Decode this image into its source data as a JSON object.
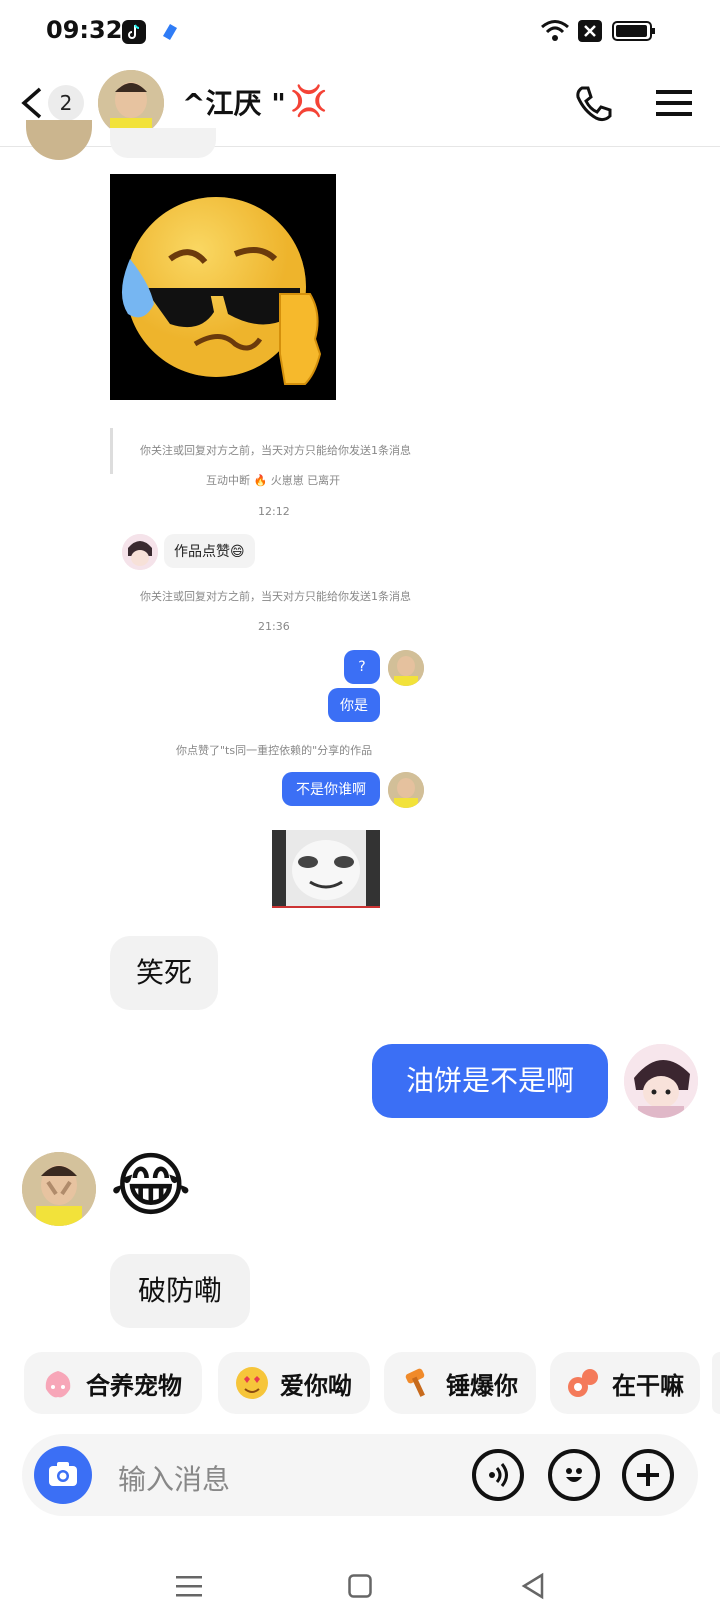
{
  "status": {
    "time": "09:32"
  },
  "header": {
    "unread_count": "2",
    "contact_name": "^江厌 \"",
    "anger_emoji": "💢"
  },
  "messages": {
    "mini": {
      "note1": "你关注或回复对方之前，当天对方只能给你发送1条消息",
      "note2": "互动中断 🔥 火崽崽 已离开",
      "time1": "12:12",
      "in1": "作品点赞😄",
      "note3": "你关注或回复对方之前，当天对方只能给你发送1条消息",
      "time2": "21:36",
      "out1": "?",
      "out2": "你是",
      "note4": "你点赞了\"ts同一重控依赖的\"分享的作品",
      "out3": "不是你谁啊"
    },
    "in_xiaosi": "笑死",
    "out_main": "油饼是不是啊",
    "in_emoji": "😂",
    "in_pofang": "破防嘞"
  },
  "quick_replies": [
    {
      "label": "合养宠物"
    },
    {
      "label": "爱你呦"
    },
    {
      "label": "锤爆你"
    },
    {
      "label": "在干嘛"
    }
  ],
  "input": {
    "placeholder": "输入消息"
  }
}
